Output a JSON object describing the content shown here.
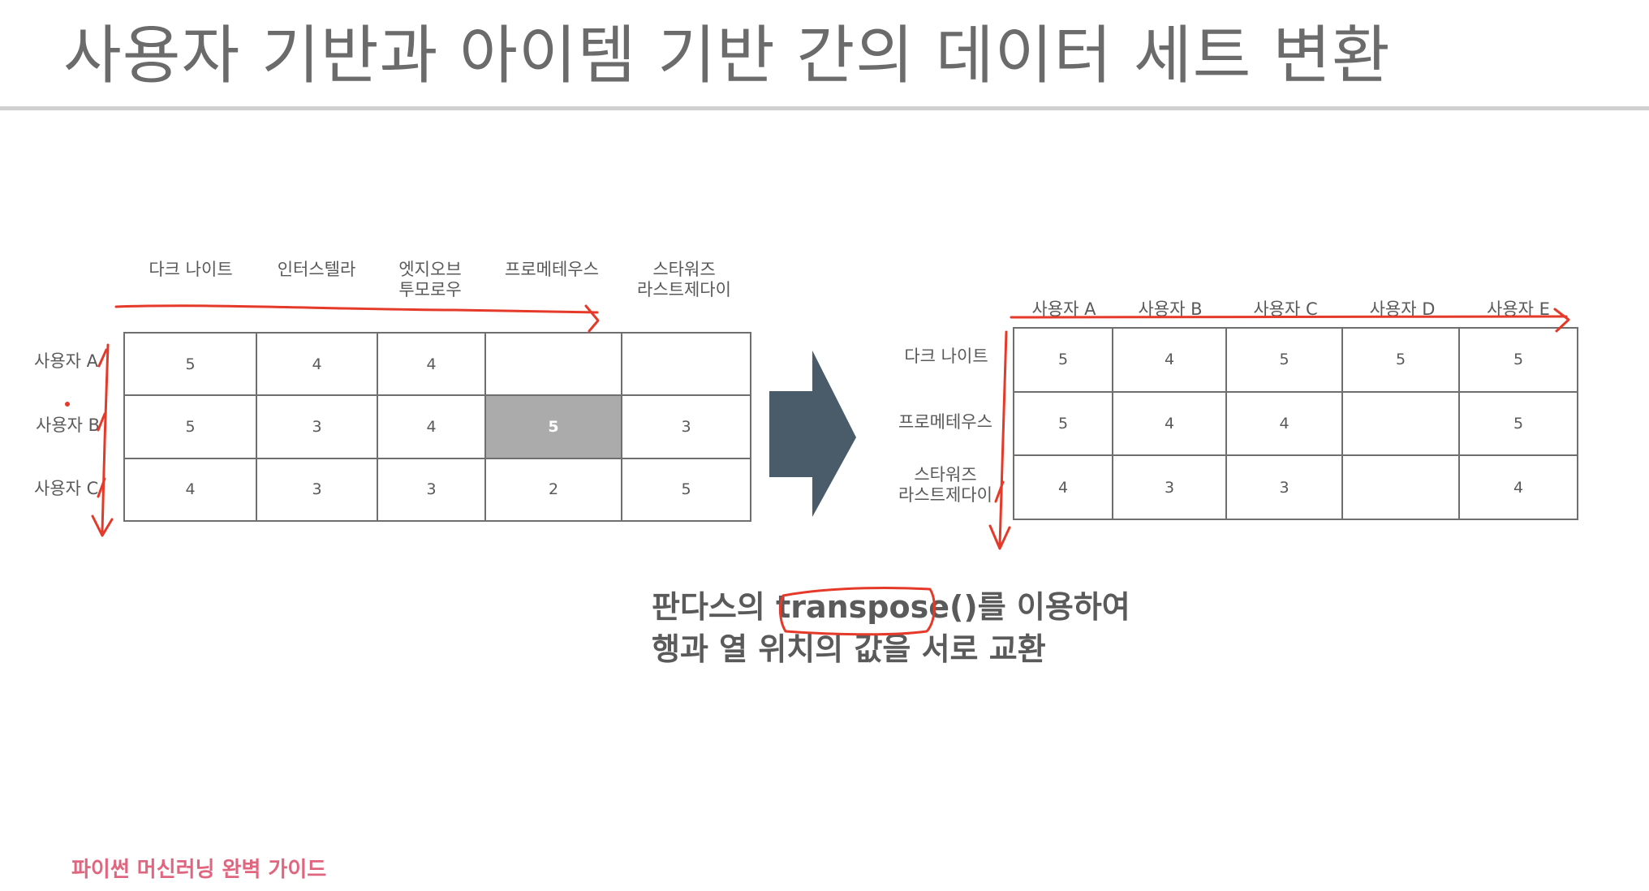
{
  "title": "사용자 기반과 아이템 기반 간의 데이터 세트 변환",
  "colors": {
    "annotation": "#e53a2a",
    "arrow": "#4a5b6a",
    "highlight_cell": "#ababab",
    "footer": "#e06680"
  },
  "left_table": {
    "columns": [
      "다크 나이트",
      "인터스텔라",
      "엣지오브\n투모로우",
      "프로메테우스",
      "스타워즈\n라스트제다이"
    ],
    "rows": [
      {
        "label": "사용자 A",
        "cells": [
          "5",
          "4",
          "4",
          "",
          ""
        ]
      },
      {
        "label": "사용자 B",
        "cells": [
          "5",
          "3",
          "4",
          "5",
          "3"
        ]
      },
      {
        "label": "사용자 C",
        "cells": [
          "4",
          "3",
          "3",
          "2",
          "5"
        ]
      }
    ]
  },
  "right_table": {
    "columns": [
      "사용자 A",
      "사용자 B",
      "사용자 C",
      "사용자 D",
      "사용자 E"
    ],
    "rows": [
      {
        "label": "다크 나이트",
        "cells": [
          "5",
          "4",
          "5",
          "5",
          "5"
        ]
      },
      {
        "label": "프로메테우스",
        "cells": [
          "5",
          "4",
          "4",
          "",
          "5"
        ]
      },
      {
        "label": "스타워즈\n라스트제다이",
        "cells": [
          "4",
          "3",
          "3",
          "",
          "4"
        ]
      }
    ]
  },
  "caption": {
    "prefix": "판다스의 ",
    "code": "transpose()",
    "suffix": "를 이용하여",
    "line2": "행과 열 위치의 값을 서로 교환"
  },
  "footer": "파이썬 머신러닝 완벽 가이드"
}
